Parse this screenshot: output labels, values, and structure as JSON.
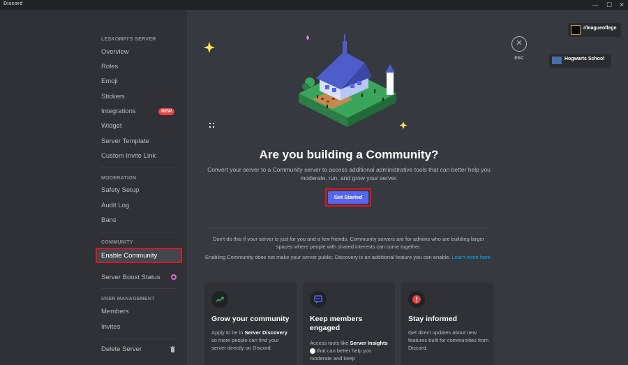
{
  "window": {
    "title": "Discord",
    "controls": {
      "minimize": "—",
      "maximize": "☐",
      "close": "✕"
    }
  },
  "sidebar": {
    "server_header": "LESKOMPI'S SERVER",
    "server_items": [
      "Overview",
      "Roles",
      "Emoji",
      "Stickers",
      "Integrations",
      "Widget",
      "Server Template",
      "Custom Invite Link"
    ],
    "new_badge": "NEW",
    "moderation_header": "MODERATION",
    "moderation_items": [
      "Safety Setup",
      "Audit Log",
      "Bans"
    ],
    "community_header": "COMMUNITY",
    "enable_community": "Enable Community",
    "server_boost": "Server Boost Status",
    "user_mgmt_header": "USER MANAGEMENT",
    "user_mgmt_items": [
      "Members",
      "Invites"
    ],
    "delete_server": "Delete Server"
  },
  "main": {
    "headline": "Are you building a Community?",
    "subtext": "Convert your server to a Community server to access additional administrative tools that can better help you moderate, run, and grow your server.",
    "cta": "Get Started",
    "note1": "Don't do this if your server is just for you and a few friends. Community servers are for admins who are building larger spaces where people with shared interests can come together.",
    "note2_text": "Enabling Community does not make your server public. Discovery is an additional feature you can enable.",
    "note2_link": "Learn more here.",
    "esc_label": "ESC",
    "cards": [
      {
        "title": "Grow your community",
        "body_pre": "Apply to be in",
        "body_bold": "Server Discovery",
        "body_post": "so more people can find your server directly on Discord.",
        "icon": "trending-up-icon"
      },
      {
        "title": "Keep members engaged",
        "body_pre": "Access tools like",
        "body_bold": "Server Insights",
        "body_post": "that can better help you moderate and keep",
        "icon": "chat-icon"
      },
      {
        "title": "Stay informed",
        "body_pre": "",
        "body_bold": "",
        "body_post": "Get direct updates about new features built for communities from Discord.",
        "icon": "info-icon"
      }
    ]
  },
  "overlay": {
    "pill1": "r/leagueoflege",
    "pill2": "Hogwarts School"
  },
  "colors": {
    "accent": "#5865f2",
    "highlight": "#e0161e",
    "link": "#00aff4",
    "badge": "#ed4245"
  }
}
